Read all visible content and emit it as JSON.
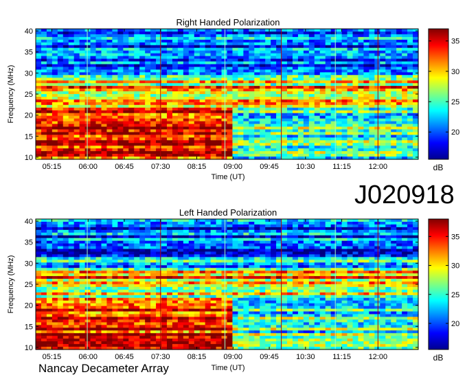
{
  "figure": {
    "code": "J020918",
    "footer": "Nancay Decameter Array"
  },
  "chart_data": [
    {
      "type": "heatmap",
      "title": "Right Handed Polarization",
      "xlabel": "Time (UT)",
      "ylabel": "Frequency (MHz)",
      "xticks": [
        "05:15",
        "06:00",
        "06:45",
        "07:30",
        "08:15",
        "09:00",
        "09:45",
        "10:30",
        "11:15",
        "12:00"
      ],
      "xlim": [
        "04:55",
        "12:50"
      ],
      "yticks": [
        10,
        15,
        20,
        25,
        30,
        35,
        40
      ],
      "ylim": [
        9.5,
        40.5
      ],
      "colorbar": {
        "label": "dB",
        "ticks": [
          20,
          25,
          30,
          35
        ],
        "range": [
          15.5,
          37
        ],
        "colormap": "jet"
      },
      "vertical_markers": [
        "05:59",
        "07:30",
        "08:50",
        "10:00",
        "11:07",
        "12:00"
      ]
    },
    {
      "type": "heatmap",
      "title": "Left Handed Polarization",
      "xlabel": "Time (UT)",
      "ylabel": "Frequency (MHz)",
      "xticks": [
        "05:15",
        "06:00",
        "06:45",
        "07:30",
        "08:15",
        "09:00",
        "09:45",
        "10:30",
        "11:15",
        "12:00"
      ],
      "xlim": [
        "04:55",
        "12:50"
      ],
      "yticks": [
        10,
        15,
        20,
        25,
        30,
        35,
        40
      ],
      "ylim": [
        9.5,
        40.5
      ],
      "colorbar": {
        "label": "dB",
        "ticks": [
          20,
          25,
          30,
          35
        ],
        "range": [
          15.5,
          38
        ],
        "colormap": "jet"
      },
      "vertical_markers": [
        "05:59",
        "07:30",
        "08:50",
        "10:00",
        "11:07",
        "12:00"
      ]
    }
  ]
}
